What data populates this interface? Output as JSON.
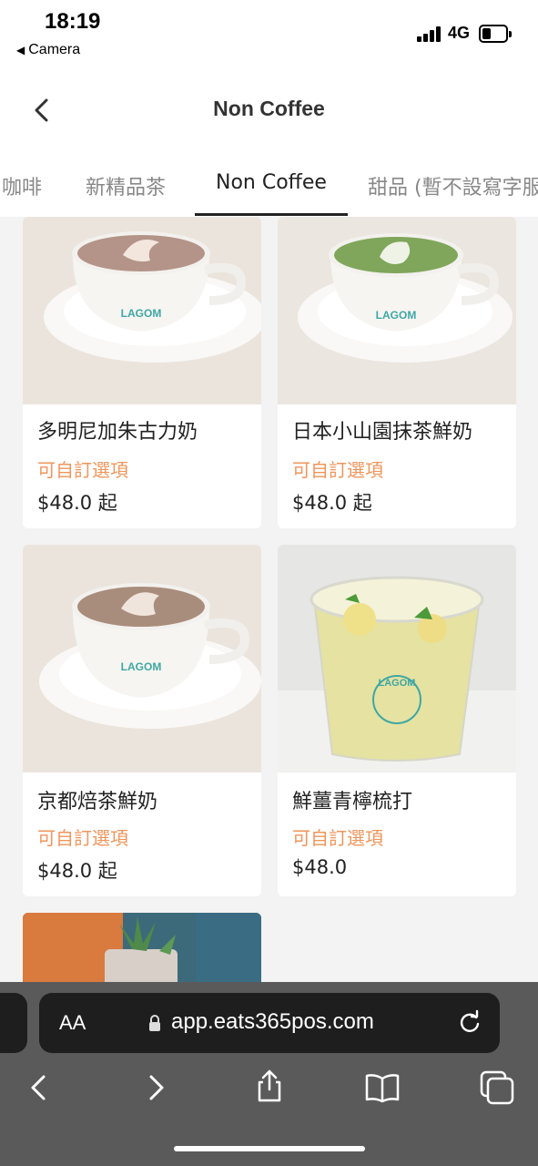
{
  "status_bar": {
    "time": "18:19",
    "back_app": "Camera",
    "network": "4G"
  },
  "header": {
    "title": "Non Coffee"
  },
  "tabs": [
    {
      "label": "咖啡"
    },
    {
      "label": "新精品茶"
    },
    {
      "label": "Non Coffee",
      "active": true
    },
    {
      "label": "甜品 (暫不設寫字服務)"
    }
  ],
  "products": [
    {
      "name": "多明尼加朱古力奶",
      "option": "可自訂選項",
      "price": "$48.0 起",
      "drink": "chocolate"
    },
    {
      "name": "日本小山園抹茶鮮奶",
      "option": "可自訂選項",
      "price": "$48.0 起",
      "drink": "matcha"
    },
    {
      "name": "京都焙茶鮮奶",
      "option": "可自訂選項",
      "price": "$48.0 起",
      "drink": "hojicha"
    },
    {
      "name": "鮮薑青檸梳打",
      "option": "可自訂選項",
      "price": "$48.0",
      "drink": "soda"
    }
  ],
  "cup_brand": "LAGOM",
  "browser": {
    "aa_label": "AA",
    "url": "app.eats365pos.com"
  },
  "colors": {
    "option_text": "#f0955a",
    "safari_bar": "#5a5a5a",
    "url_bar": "#1e1e1e"
  }
}
